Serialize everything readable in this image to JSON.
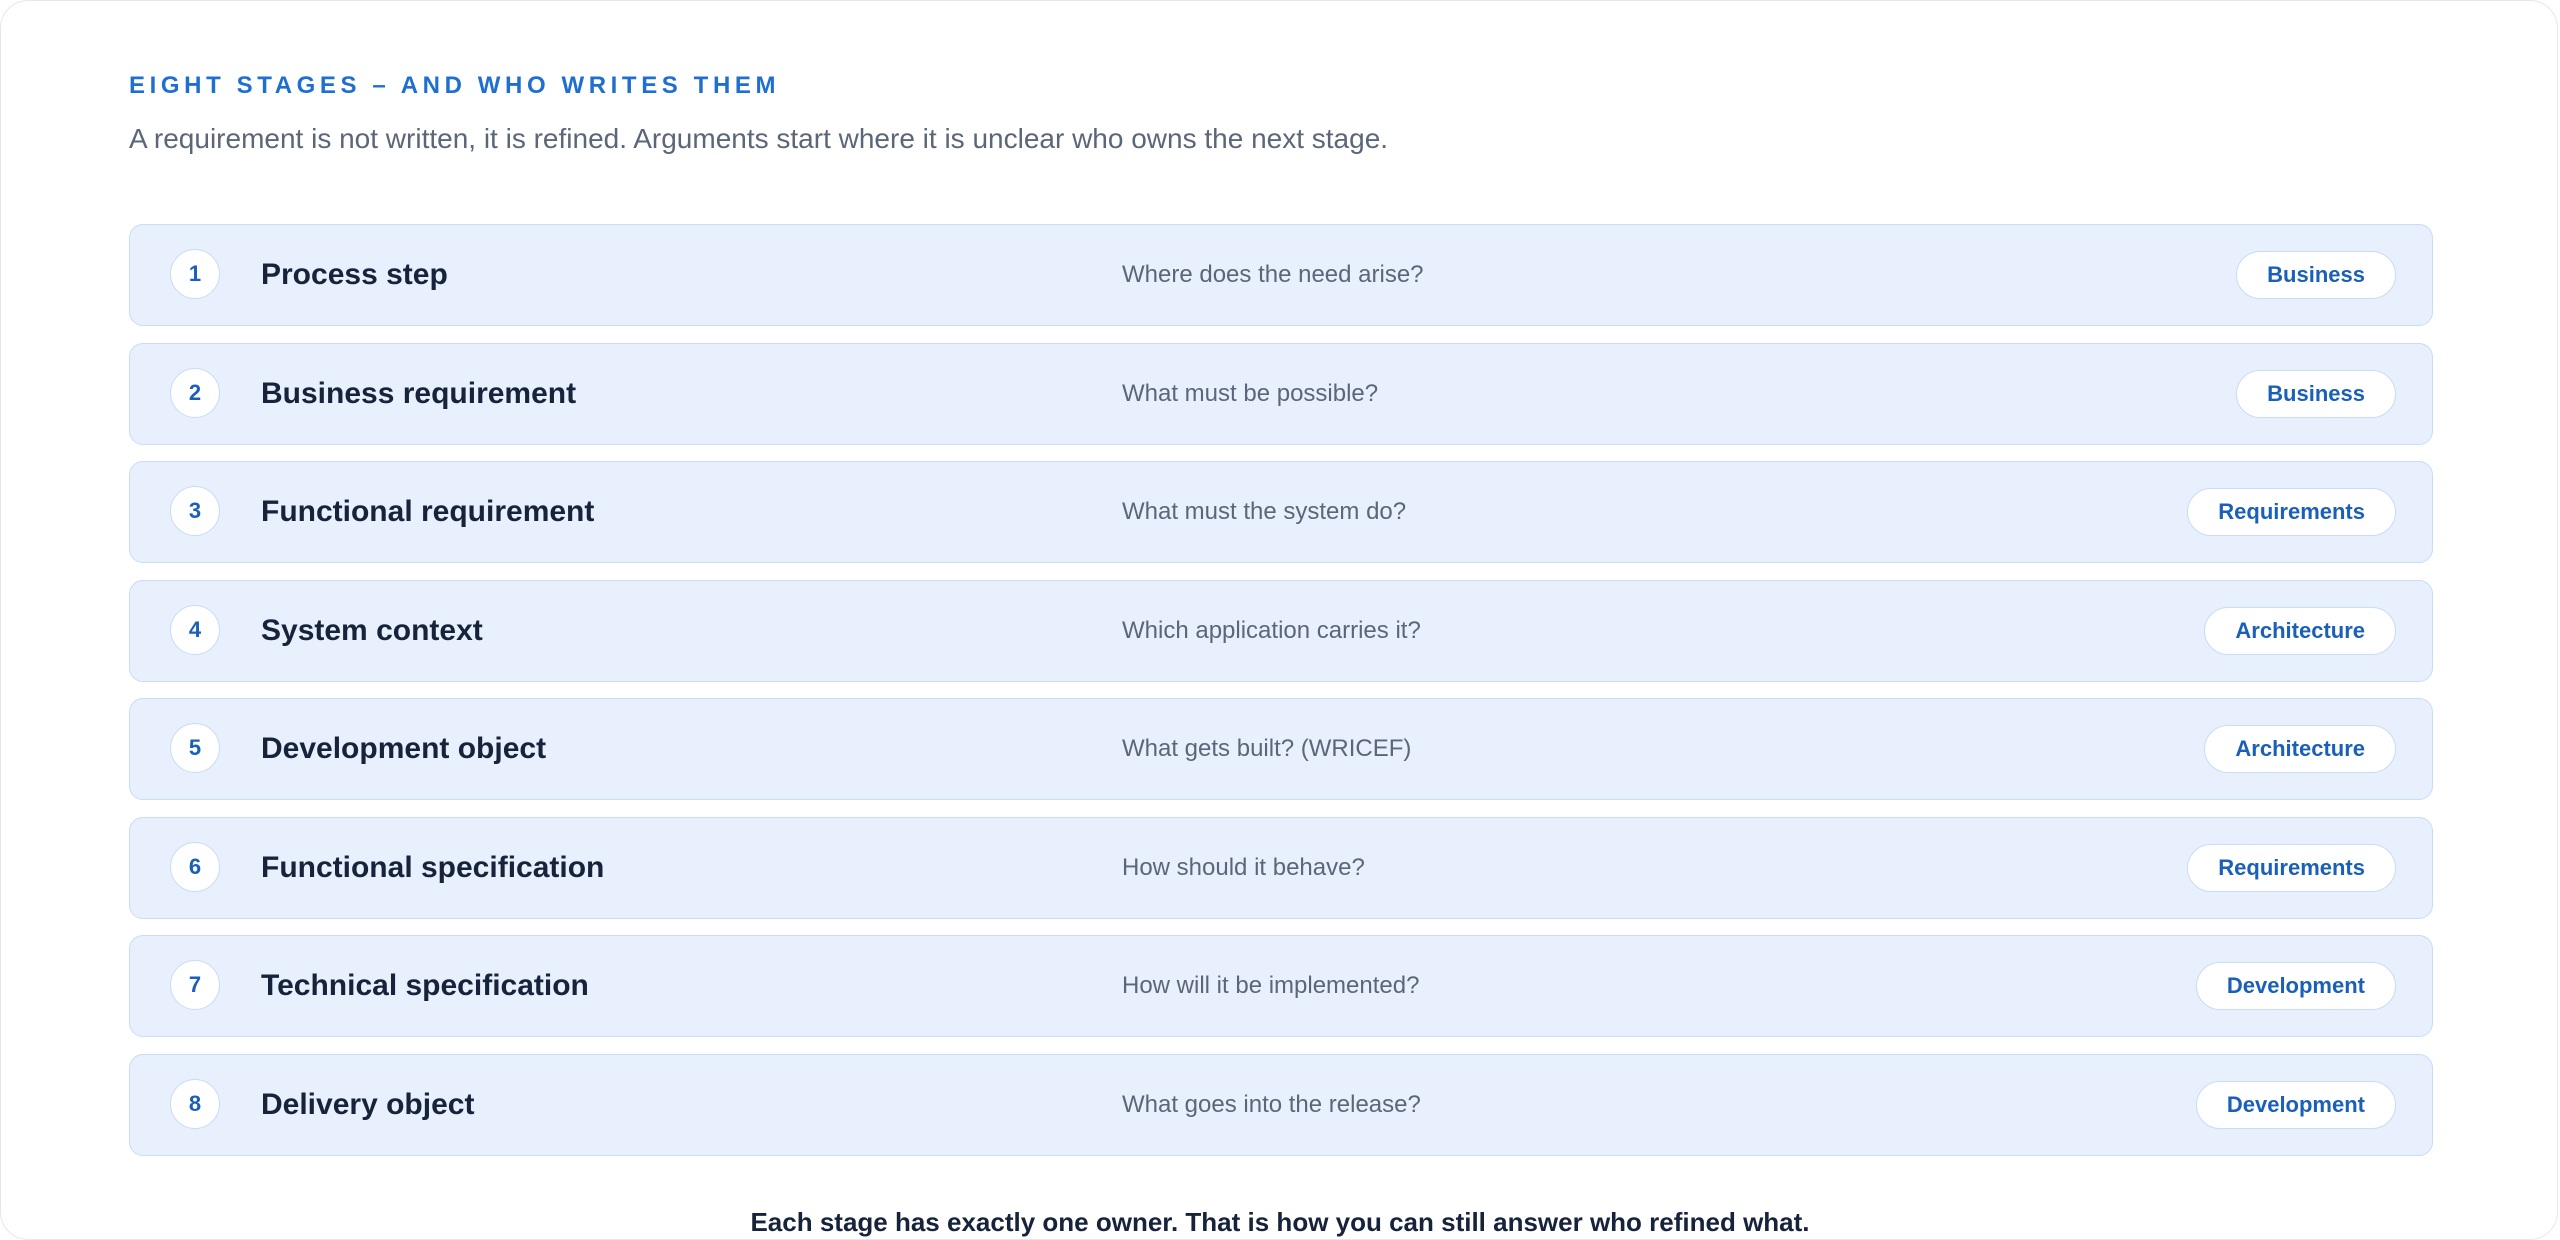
{
  "header": {
    "eyebrow": "EIGHT STAGES – AND WHO WRITES THEM",
    "subtitle": "A requirement is not written, it is refined. Arguments start where it is unclear who owns the next stage."
  },
  "stages": [
    {
      "number": "1",
      "name": "Process step",
      "question": "Where does the need arise?",
      "owner": "Business"
    },
    {
      "number": "2",
      "name": "Business requirement",
      "question": "What must be possible?",
      "owner": "Business"
    },
    {
      "number": "3",
      "name": "Functional requirement",
      "question": "What must the system do?",
      "owner": "Requirements"
    },
    {
      "number": "4",
      "name": "System context",
      "question": "Which application carries it?",
      "owner": "Architecture"
    },
    {
      "number": "5",
      "name": "Development object",
      "question": "What gets built? (WRICEF)",
      "owner": "Architecture"
    },
    {
      "number": "6",
      "name": "Functional specification",
      "question": "How should it behave?",
      "owner": "Requirements"
    },
    {
      "number": "7",
      "name": "Technical specification",
      "question": "How will it be implemented?",
      "owner": "Development"
    },
    {
      "number": "8",
      "name": "Delivery object",
      "question": "What goes into the release?",
      "owner": "Development"
    }
  ],
  "footer": {
    "note": "Each stage has exactly one owner. That is how you can still answer who refined what."
  },
  "colors": {
    "accent": "#1f6fd1",
    "row_background": "#e8f0fd",
    "row_border": "#c9dbf6",
    "heading_text": "#16233b",
    "muted_text": "#5b6678"
  }
}
